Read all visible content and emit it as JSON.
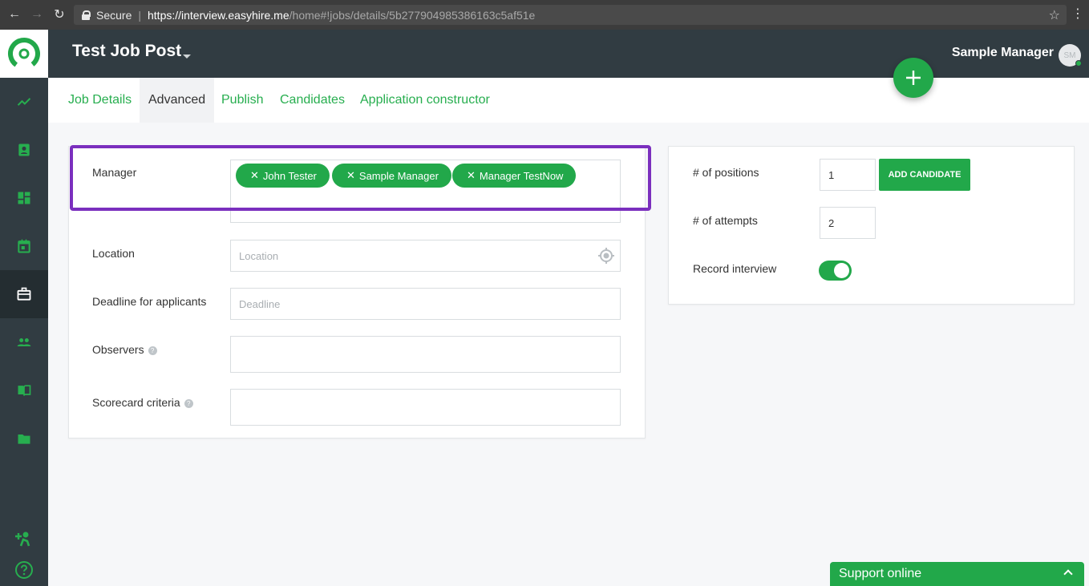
{
  "browser": {
    "secure_label": "Secure",
    "url_host": "https://interview.easyhire.me",
    "url_path": "/home#!jobs/details/5b277904985386163c5af51e"
  },
  "header": {
    "job_title": "Test Job Post",
    "user_name": "Sample Manager",
    "avatar_initials": "SM"
  },
  "tabs": [
    {
      "label": "Job Details"
    },
    {
      "label": "Advanced"
    },
    {
      "label": "Publish"
    },
    {
      "label": "Candidates"
    },
    {
      "label": "Application constructor"
    }
  ],
  "form": {
    "manager_label": "Manager",
    "managers": [
      "John Tester",
      "Sample Manager",
      "Manager TestNow"
    ],
    "location_label": "Location",
    "location_placeholder": "Location",
    "deadline_label": "Deadline for applicants",
    "deadline_placeholder": "Deadline",
    "observers_label": "Observers",
    "scorecard_label": "Scorecard criteria",
    "help_glyph": "?"
  },
  "settings": {
    "positions_label": "# of positions",
    "positions_value": "1",
    "add_candidate_label": "ADD CANDIDATE",
    "attempts_label": "# of attempts",
    "attempts_value": "2",
    "record_label": "Record interview",
    "record_on": true
  },
  "support": {
    "label": "Support online"
  },
  "colors": {
    "accent": "#22a84a",
    "sidebar": "#313c42",
    "highlight": "#7b2fbe"
  },
  "icons": [
    "arrow-left-icon",
    "arrow-right-icon",
    "reload-icon",
    "lock-icon",
    "star-icon",
    "menu-icon",
    "logo-icon",
    "trending-icon",
    "contact-icon",
    "dashboard-icon",
    "calendar-icon",
    "briefcase-icon",
    "people-icon",
    "book-icon",
    "folder-icon",
    "add-person-icon",
    "help-icon",
    "plus-icon",
    "location-target-icon",
    "chevron-up-icon"
  ]
}
